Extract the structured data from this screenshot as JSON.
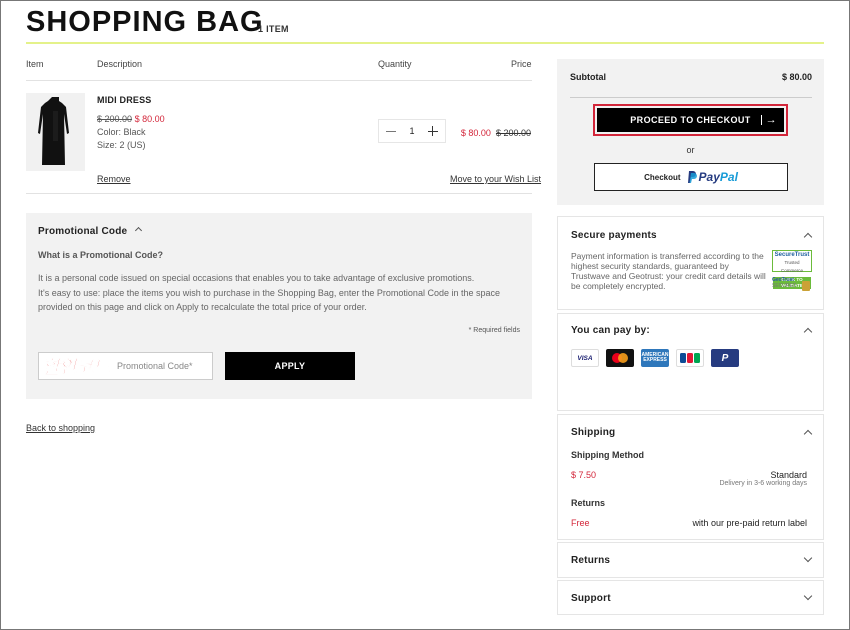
{
  "header": {
    "title": "SHOPPING BAG",
    "item_count": "1 ITEM"
  },
  "table": {
    "col_item": "Item",
    "col_description": "Description",
    "col_quantity": "Quantity",
    "col_price": "Price"
  },
  "product": {
    "name": "MIDI DRESS",
    "original_price": "$ 200.00",
    "sale_price": "$ 80.00",
    "color": "Color: Black",
    "size": "Size: 2 (US)",
    "quantity": "1",
    "row_sale_price": "$ 80.00",
    "row_original_price": "$ 200.00",
    "remove_label": "Remove",
    "wishlist_label": "Move to your Wish List"
  },
  "promo": {
    "header": "Promotional Code",
    "question": "What is a Promotional Code?",
    "text_lines": [
      "It is a personal code issued on special occasions that enables you to take advantage of exclusive promotions.",
      "It's easy to use: place the items you wish to purchase in the Shopping Bag, enter the Promotional Code in the space",
      "provided on this page and click on Apply to recalculate the total price of your order."
    ],
    "required_note": "* Required fields",
    "input_placeholder": "Promotional Code*",
    "stamp_text": "할인코드",
    "apply_label": "APPLY"
  },
  "back_link": "Back to shopping",
  "summary": {
    "subtotal_label": "Subtotal",
    "subtotal_value": "$ 80.00",
    "checkout_label": "PROCEED TO CHECKOUT",
    "or_label": "or",
    "paypal_label": "Checkout",
    "paypal_brand_pay": "Pay",
    "paypal_brand_pal": "Pal"
  },
  "secure": {
    "title": "Secure payments",
    "text": "Payment information is transferred according to the highest security standards, guaranteed by Trustwave and Geotrust: your credit card details will be completely encrypted.",
    "badge1_title": "SecureTrust",
    "badge1_sub": "Trusted Commerce",
    "badge1_click": "CLICK TO VALIDATE",
    "badge2_brand": "GeoTrust",
    "badge2_sub": "SECURED"
  },
  "pay": {
    "title": "You can pay by:",
    "visa": "VISA",
    "amex": "AMERICAN EXPRESS",
    "paypal_p": "P"
  },
  "shipping": {
    "title": "Shipping",
    "method_label": "Shipping Method",
    "method_price": "$ 7.50",
    "method_name": "Standard",
    "method_note": "Delivery in 3-6 working days",
    "returns_label": "Returns",
    "returns_price": "Free",
    "returns_note": "with our pre-paid return label"
  },
  "returns_card": {
    "title": "Returns"
  },
  "support_card": {
    "title": "Support"
  },
  "colors": {
    "accent_red": "#d3263a",
    "title_rule": "#e4f28a",
    "panel_gray": "#f2f2f2",
    "paypal_dark": "#253b80",
    "paypal_light": "#179bd7"
  }
}
